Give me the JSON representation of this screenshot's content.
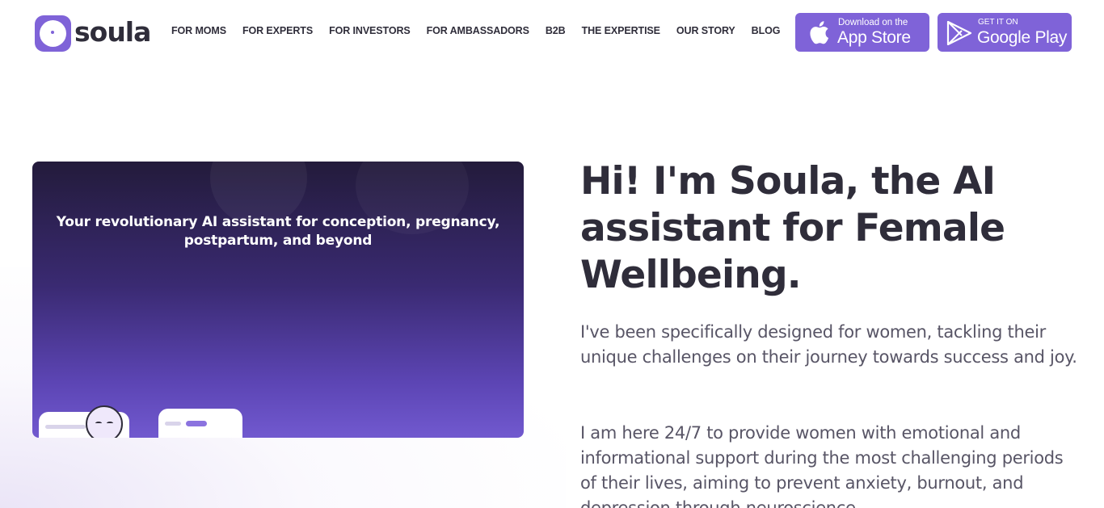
{
  "brand": {
    "name": "soula",
    "accent_color": "#7f63d8",
    "text_color": "#2f2d3a"
  },
  "nav": {
    "items": [
      {
        "label": "FOR MOMS"
      },
      {
        "label": "FOR EXPERTS"
      },
      {
        "label": "FOR INVESTORS"
      },
      {
        "label": "FOR AMBASSADORS"
      },
      {
        "label": "B2B"
      },
      {
        "label": "THE EXPERTISE"
      },
      {
        "label": "OUR STORY"
      },
      {
        "label": "BLOG"
      }
    ]
  },
  "stores": {
    "app_store": {
      "small": "Download on the",
      "big": "App Store",
      "icon": "apple-icon"
    },
    "google_play": {
      "small": "GET IT ON",
      "big": "Google Play",
      "icon": "play-triangle-icon"
    }
  },
  "hero": {
    "video_caption": "Your revolutionary AI assistant for conception, pregnancy, postpartum, and beyond",
    "title": "Hi! I'm Soula, the AI assistant for Female Wellbeing.",
    "paragraphs": [
      "I've been specifically designed for women, tackling their unique challenges on their journey towards success and joy.",
      "I am here 24/7 to provide women with emotional and informational support during the most challenging periods of their lives, aiming to prevent anxiety, burnout, and depression through neuroscience"
    ]
  }
}
